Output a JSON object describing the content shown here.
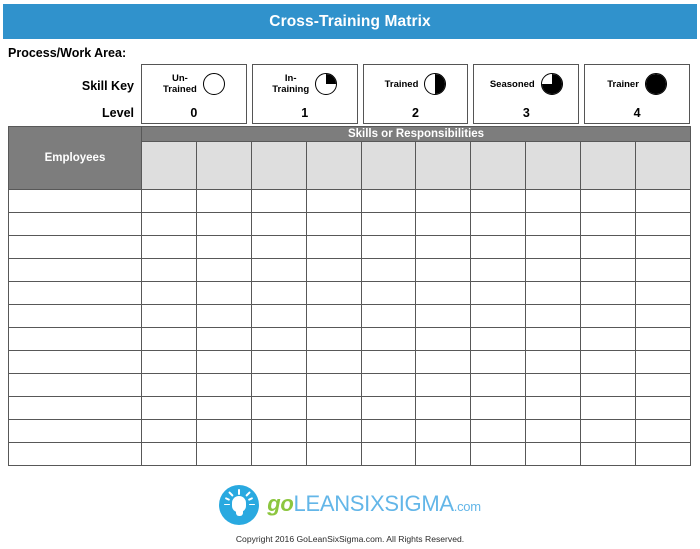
{
  "header": {
    "title": "Cross-Training Matrix",
    "bar_color": "#3092cc"
  },
  "form": {
    "process_label": "Process/Work Area:",
    "skill_key_label": "Skill Key",
    "level_label": "Level"
  },
  "skill_key": {
    "items": [
      {
        "name": "Un-\nTrained",
        "level": "0",
        "icon": "circle-empty-icon",
        "fill": "q0"
      },
      {
        "name": "In-\nTraining",
        "level": "1",
        "icon": "circle-quarter-icon",
        "fill": "q1"
      },
      {
        "name": "Trained",
        "level": "2",
        "icon": "circle-half-icon",
        "fill": "q2"
      },
      {
        "name": "Seasoned",
        "level": "3",
        "icon": "circle-three-quarter-icon",
        "fill": "q3"
      },
      {
        "name": "Trainer",
        "level": "4",
        "icon": "circle-full-icon",
        "fill": "q4"
      }
    ]
  },
  "matrix": {
    "employees_header": "Employees",
    "skills_banner": "Skills or Responsibilities",
    "skill_columns": [
      "",
      "",
      "",
      "",
      "",
      "",
      "",
      "",
      "",
      ""
    ],
    "row_count": 12,
    "rows": [
      {
        "employee": "",
        "skills": [
          "",
          "",
          "",
          "",
          "",
          "",
          "",
          "",
          "",
          ""
        ]
      },
      {
        "employee": "",
        "skills": [
          "",
          "",
          "",
          "",
          "",
          "",
          "",
          "",
          "",
          ""
        ]
      },
      {
        "employee": "",
        "skills": [
          "",
          "",
          "",
          "",
          "",
          "",
          "",
          "",
          "",
          ""
        ]
      },
      {
        "employee": "",
        "skills": [
          "",
          "",
          "",
          "",
          "",
          "",
          "",
          "",
          "",
          ""
        ]
      },
      {
        "employee": "",
        "skills": [
          "",
          "",
          "",
          "",
          "",
          "",
          "",
          "",
          "",
          ""
        ]
      },
      {
        "employee": "",
        "skills": [
          "",
          "",
          "",
          "",
          "",
          "",
          "",
          "",
          "",
          ""
        ]
      },
      {
        "employee": "",
        "skills": [
          "",
          "",
          "",
          "",
          "",
          "",
          "",
          "",
          "",
          ""
        ]
      },
      {
        "employee": "",
        "skills": [
          "",
          "",
          "",
          "",
          "",
          "",
          "",
          "",
          "",
          ""
        ]
      },
      {
        "employee": "",
        "skills": [
          "",
          "",
          "",
          "",
          "",
          "",
          "",
          "",
          "",
          ""
        ]
      },
      {
        "employee": "",
        "skills": [
          "",
          "",
          "",
          "",
          "",
          "",
          "",
          "",
          "",
          ""
        ]
      },
      {
        "employee": "",
        "skills": [
          "",
          "",
          "",
          "",
          "",
          "",
          "",
          "",
          "",
          ""
        ]
      },
      {
        "employee": "",
        "skills": [
          "",
          "",
          "",
          "",
          "",
          "",
          "",
          "",
          "",
          ""
        ]
      }
    ],
    "header_gray": "#7d7d7d",
    "skill_header_gray": "#dedede"
  },
  "footer": {
    "logo_word_go": "go",
    "logo_word_lean": "LEANSIXSIGMA",
    "logo_word_com": ".com",
    "logo_icon": "lightbulb-icon",
    "logo_circle_color": "#29a9e0",
    "copyright": "Copyright 2016 GoLeanSixSigma.com. All Rights Reserved."
  }
}
